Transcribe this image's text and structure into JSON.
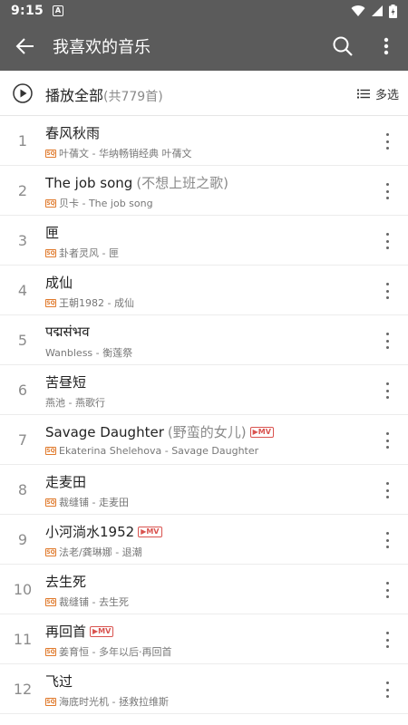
{
  "status": {
    "time": "9:15",
    "notif_icon": "A"
  },
  "appbar": {
    "title": "我喜欢的音乐"
  },
  "playall": {
    "label": "播放全部",
    "count": "(共779首)",
    "multi_label": "多选"
  },
  "songs": [
    {
      "index": "1",
      "title": "春风秋雨",
      "alias": "",
      "mv": "",
      "sq": "SQ",
      "subtitle": "叶蒨文 - 华纳畅销经典 叶蒨文"
    },
    {
      "index": "2",
      "title": "The job song",
      "alias": "(不想上班之歌)",
      "mv": "",
      "sq": "SQ",
      "subtitle": "贝卡 - The job song"
    },
    {
      "index": "3",
      "title": "匣",
      "alias": "",
      "mv": "",
      "sq": "SQ",
      "subtitle": "卦者灵风 - 匣"
    },
    {
      "index": "4",
      "title": "成仙",
      "alias": "",
      "mv": "",
      "sq": "SQ",
      "subtitle": "王朝1982 - 成仙"
    },
    {
      "index": "5",
      "title": "पद्मसंभव",
      "alias": "",
      "mv": "",
      "sq": "",
      "subtitle": "Wanbless - 衡莲祭"
    },
    {
      "index": "6",
      "title": "苦昼短",
      "alias": "",
      "mv": "",
      "sq": "",
      "subtitle": "燕池 - 燕歌行"
    },
    {
      "index": "7",
      "title": "Savage Daughter",
      "alias": "(野蛮的女儿)",
      "mv": "▶MV",
      "sq": "SQ",
      "subtitle": "Ekaterina Shelehova - Savage Daughter"
    },
    {
      "index": "8",
      "title": "走麦田",
      "alias": "",
      "mv": "",
      "sq": "SQ",
      "subtitle": "裁缝铺 - 走麦田"
    },
    {
      "index": "9",
      "title": "小河淌水1952",
      "alias": "",
      "mv": "▶MV",
      "sq": "SQ",
      "subtitle": "法老/龚琳娜 - 退潮"
    },
    {
      "index": "10",
      "title": "去生死",
      "alias": "",
      "mv": "",
      "sq": "SQ",
      "subtitle": "裁缝铺 - 去生死"
    },
    {
      "index": "11",
      "title": "再回首",
      "alias": "",
      "mv": "▶MV",
      "sq": "SQ",
      "subtitle": "姜育恒 - 多年以后·再回首"
    },
    {
      "index": "12",
      "title": "飞过",
      "alias": "",
      "mv": "",
      "sq": "SQ",
      "subtitle": "海底时光机 - 拯救拉维斯"
    }
  ]
}
